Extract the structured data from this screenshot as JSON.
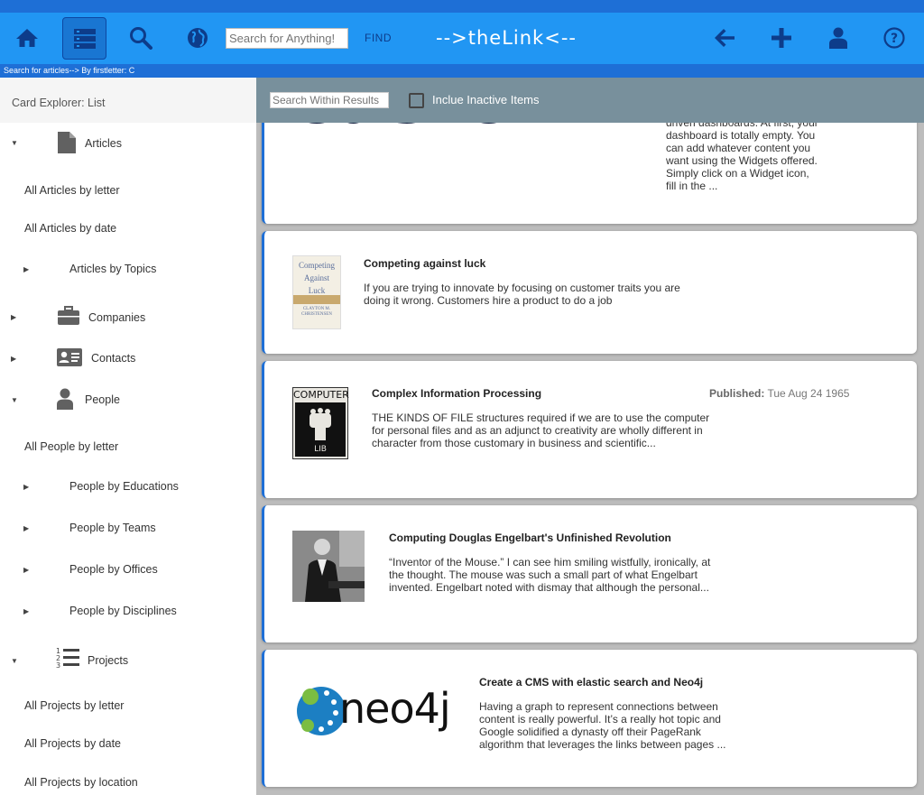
{
  "app": {
    "title": "-->theLink<--",
    "search_placeholder": "Search for Anything!",
    "find_label": "FIND",
    "status_text": "Search for articles--> By firstletter: C"
  },
  "sidebar": {
    "header": "Card Explorer: List",
    "items": [
      {
        "label": "Articles",
        "arrow": "▼",
        "icon": "document-icon"
      },
      {
        "label": "All Articles by letter"
      },
      {
        "label": "All Articles by date"
      },
      {
        "label": "Articles by Topics",
        "arrow": "▶"
      },
      {
        "label": "Companies",
        "arrow": "▶",
        "icon": "briefcase-icon"
      },
      {
        "label": "Contacts",
        "arrow": "▶",
        "icon": "contact-card-icon"
      },
      {
        "label": "People",
        "arrow": "▼",
        "icon": "person-icon"
      },
      {
        "label": "All People by letter"
      },
      {
        "label": "People by Educations",
        "arrow": "▶"
      },
      {
        "label": "People by Teams",
        "arrow": "▶"
      },
      {
        "label": "People by Offices",
        "arrow": "▶"
      },
      {
        "label": "People by Disciplines",
        "arrow": "▶"
      },
      {
        "label": "Projects",
        "arrow": "▼",
        "icon": "numbered-list-icon"
      },
      {
        "label": "All Projects by letter"
      },
      {
        "label": "All Projects by date"
      },
      {
        "label": "All Projects by location"
      }
    ]
  },
  "filter": {
    "placeholder": "Search Within Results",
    "checkbox_label": "Inclue Inactive Items"
  },
  "cards": [
    {
      "title": "",
      "text": "driven dashboards. At first, your dashboard is totally empty. You can add whatever content you want using the Widgets offered. Simply click on a Widget icon, fill in the ...",
      "thumb": "custor"
    },
    {
      "title": "Competing against luck",
      "text": "If you are trying to innovate by focusing on customer traits you are doing it wrong. Customers hire a product to do a job",
      "thumb_lines": [
        "Competing",
        "Against",
        "Luck",
        "CLAYTON M.",
        "CHRISTENSEN"
      ]
    },
    {
      "title": "Complex Information Processing",
      "text": "THE KINDS OF FILE structures required if we are to use the computer for personal files and as an adjunct to creativity are wholly different in character from those customary in business and scientific...",
      "published_label": "Published:",
      "published_value": "Tue Aug 24 1965",
      "thumb_lines": [
        "COMPUTER",
        "LIB"
      ]
    },
    {
      "title": "Computing Douglas Engelbart's Unfinished Revolution",
      "text": "“Inventor of the Mouse.” I can see him smiling wistfully, ironically, at the thought. The mouse was such a small part of what Engelbart invented. Engelbart noted with dismay that although the personal..."
    },
    {
      "title": "Create a CMS with elastic search and Neo4j",
      "text": "Having a graph to represent connections between content is really powerful. It’s a really hot topic and Google solidified a dynasty off their PageRank algorithm that leverages the links between pages ...",
      "thumb_lines": [
        "neo4j"
      ]
    }
  ],
  "colors": {
    "appbar": "#2196f3",
    "strip": "#1e6fd6",
    "filterbar": "#78909c",
    "icon_dark": "#0d3c8a"
  }
}
